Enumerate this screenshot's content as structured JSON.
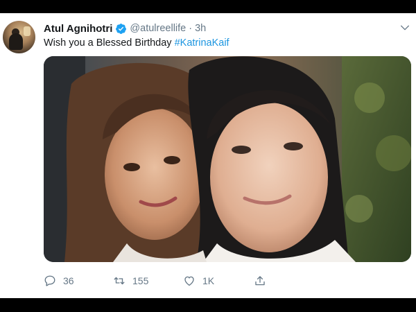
{
  "tweet": {
    "author_name": "Atul Agnihotri",
    "handle": "@atulreellife",
    "separator": "·",
    "time_ago": "3h",
    "text_before": "Wish you a Blessed Birthday ",
    "hashtag": "#KatrinaKaif",
    "media_alt": "photo"
  },
  "actions": {
    "replies": "36",
    "retweets": "155",
    "likes": "1K"
  },
  "colors": {
    "verified_blue": "#1da1f2",
    "link_blue": "#1b95e0",
    "meta_gray": "#657786"
  },
  "icons": [
    "verified-badge-icon",
    "chevron-down-icon",
    "reply-icon",
    "retweet-icon",
    "like-icon",
    "share-icon"
  ]
}
